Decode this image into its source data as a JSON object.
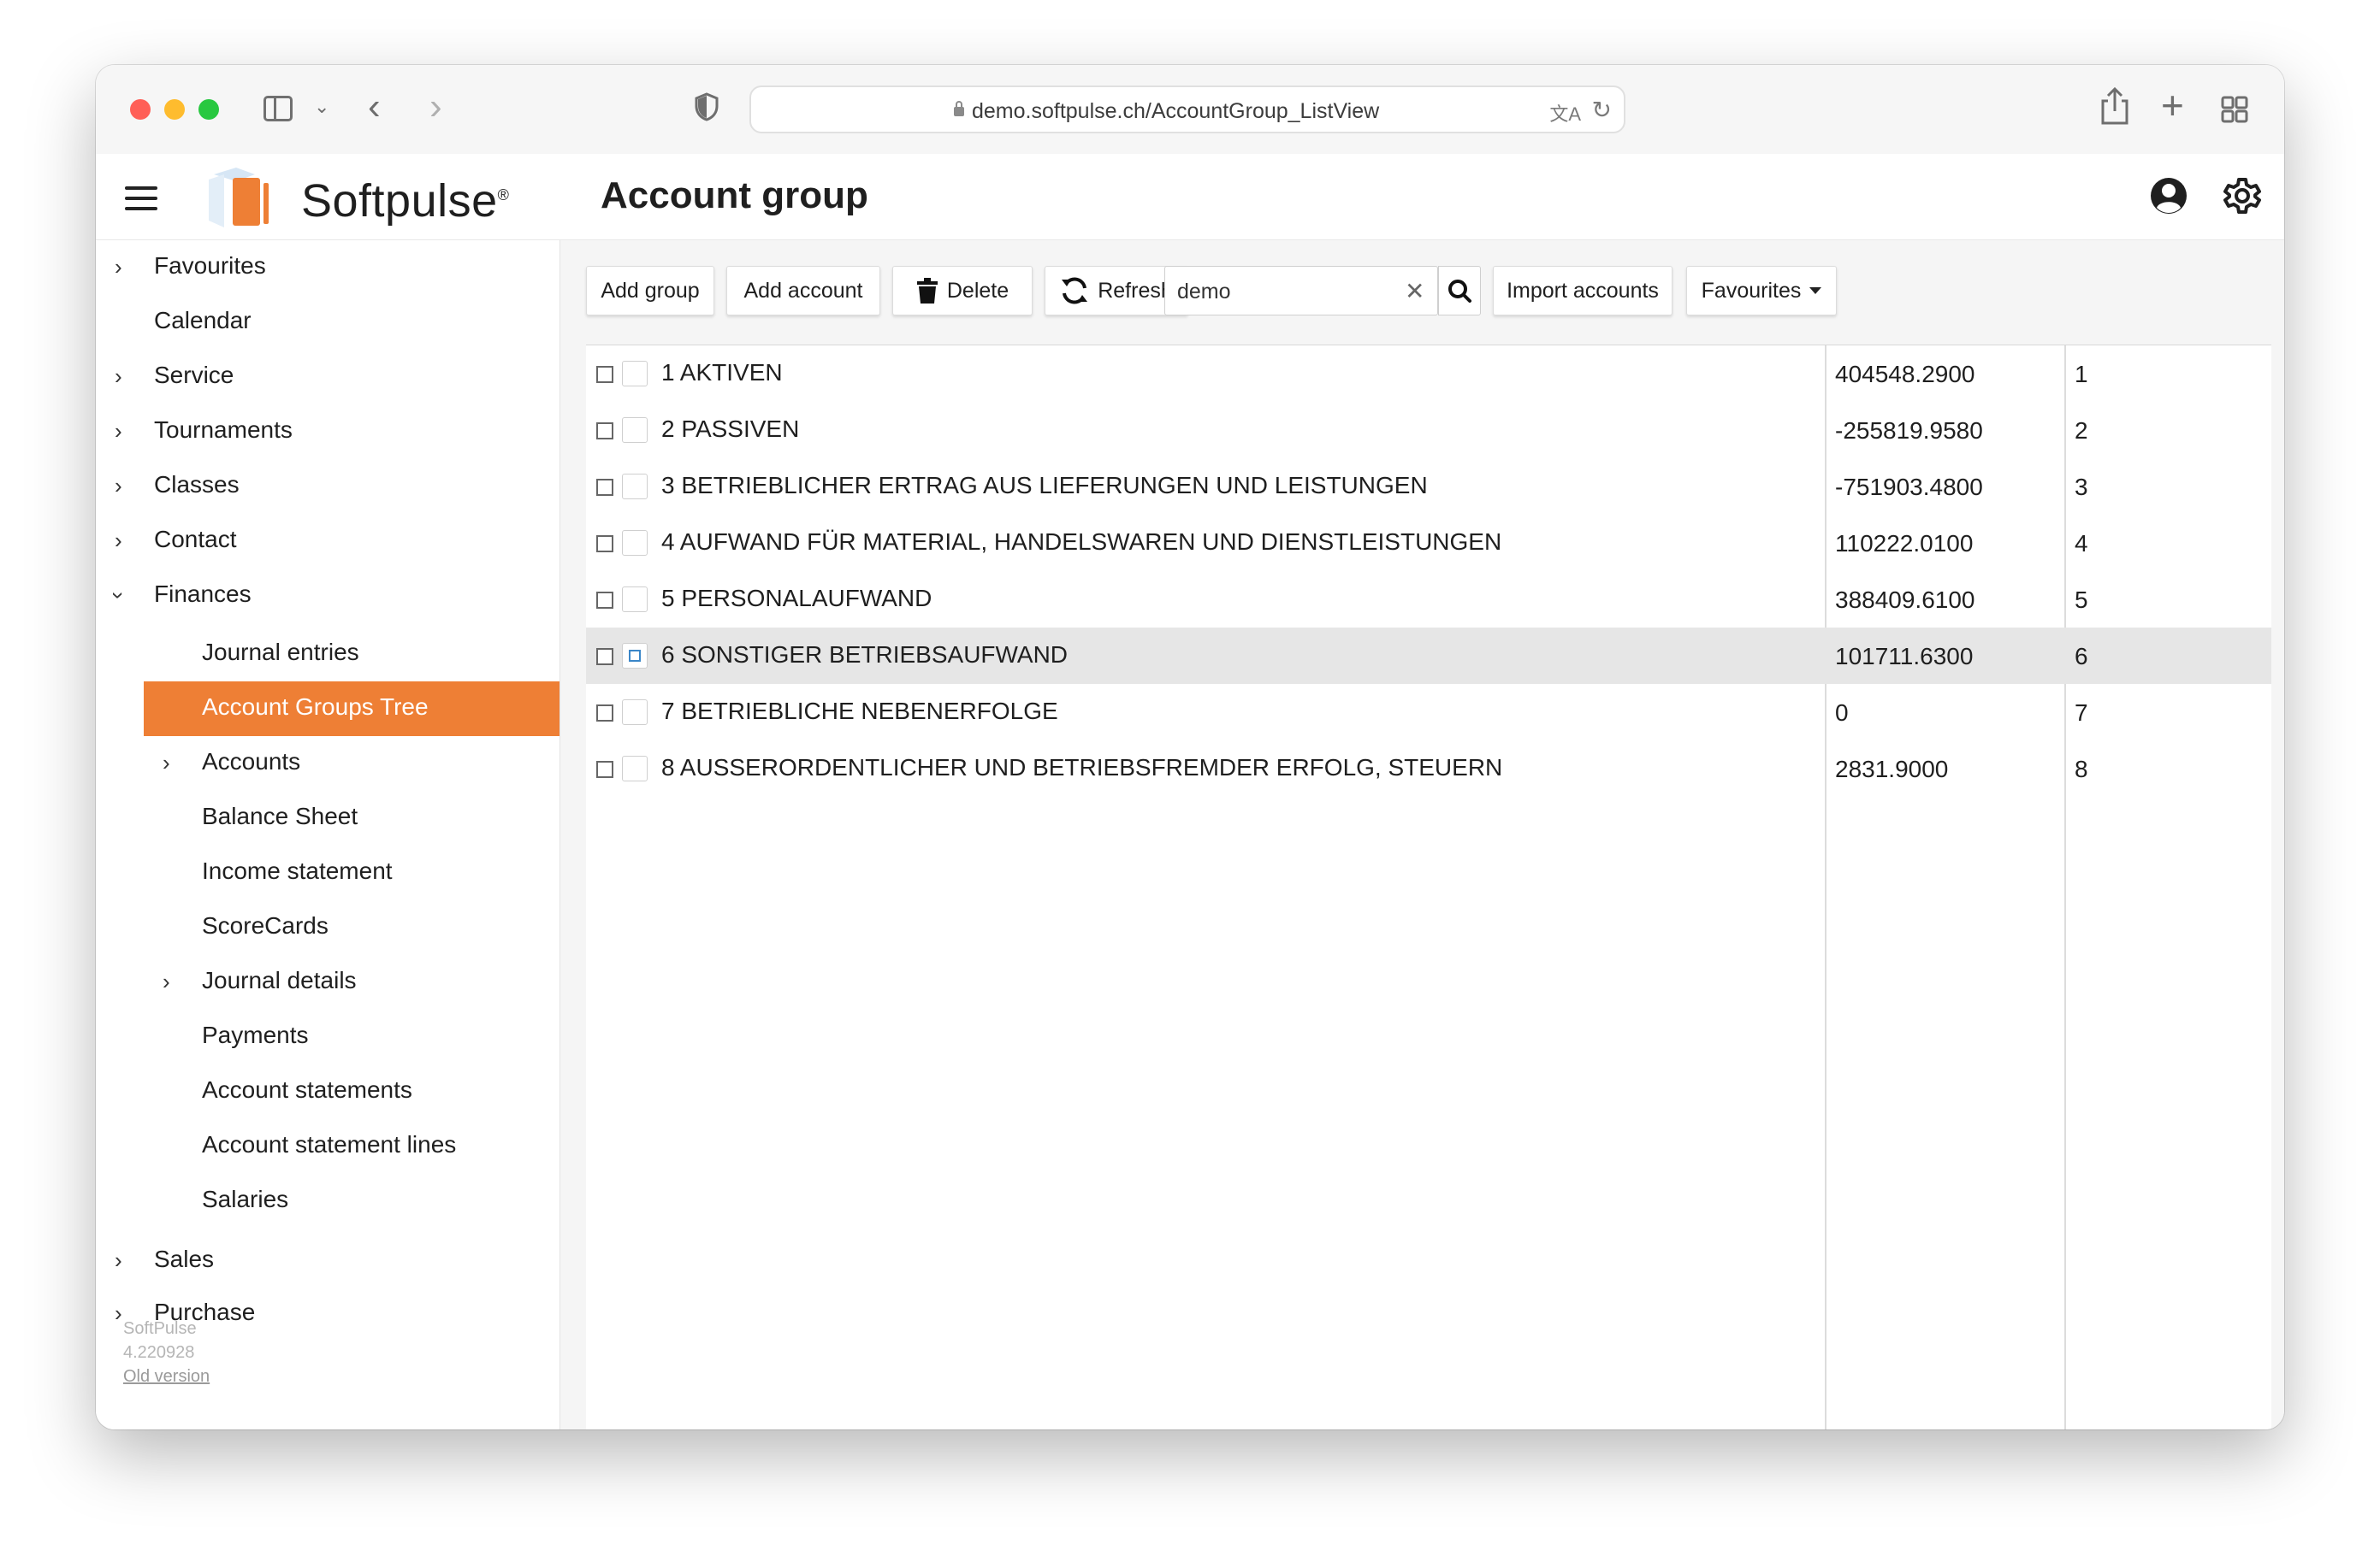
{
  "browser": {
    "url": "demo.softpulse.ch/AccountGroup_ListView"
  },
  "header": {
    "logo_text": "Softpulse",
    "logo_reg": "®",
    "page_title": "Account group",
    "brand_color": "#ee7f35"
  },
  "sidebar": {
    "items": [
      {
        "label": "Favourites",
        "level": 0,
        "expandable": true
      },
      {
        "label": "Calendar",
        "level": 0,
        "expandable": false
      },
      {
        "label": "Service",
        "level": 0,
        "expandable": true
      },
      {
        "label": "Tournaments",
        "level": 0,
        "expandable": true
      },
      {
        "label": "Classes",
        "level": 0,
        "expandable": true
      },
      {
        "label": "Contact",
        "level": 0,
        "expandable": true
      },
      {
        "label": "Finances",
        "level": 0,
        "expandable": true,
        "expanded": true
      },
      {
        "label": "Journal entries",
        "level": 1,
        "expandable": false
      },
      {
        "label": "Account Groups Tree",
        "level": 1,
        "expandable": false,
        "active": true
      },
      {
        "label": "Accounts",
        "level": 1,
        "expandable": true
      },
      {
        "label": "Balance Sheet",
        "level": 1,
        "expandable": false
      },
      {
        "label": "Income statement",
        "level": 1,
        "expandable": false
      },
      {
        "label": "ScoreCards",
        "level": 1,
        "expandable": false
      },
      {
        "label": "Journal details",
        "level": 1,
        "expandable": true
      },
      {
        "label": "Payments",
        "level": 1,
        "expandable": false
      },
      {
        "label": "Account statements",
        "level": 1,
        "expandable": false
      },
      {
        "label": "Account statement lines",
        "level": 1,
        "expandable": false
      },
      {
        "label": "Salaries",
        "level": 1,
        "expandable": false
      },
      {
        "label": "Sales",
        "level": 0,
        "expandable": true
      },
      {
        "label": "Purchase",
        "level": 0,
        "expandable": true
      }
    ],
    "footer": {
      "app_name": "SoftPulse",
      "version": "4.220928",
      "old_version_link": "Old version"
    }
  },
  "toolbar": {
    "add_group": "Add group",
    "add_account": "Add account",
    "delete": "Delete",
    "refresh": "Refresh",
    "search_value": "demo",
    "import_accounts": "Import accounts",
    "favourites": "Favourites"
  },
  "table": {
    "rows": [
      {
        "name": "1 AKTIVEN",
        "amount": "404548.2900",
        "number": "1"
      },
      {
        "name": "2 PASSIVEN",
        "amount": "-255819.9580",
        "number": "2"
      },
      {
        "name": "3 BETRIEBLICHER ERTRAG AUS LIEFERUNGEN UND LEISTUNGEN",
        "amount": "-751903.4800",
        "number": "3"
      },
      {
        "name": "4 AUFWAND FÜR MATERIAL, HANDELSWAREN UND DIENSTLEISTUNGEN",
        "amount": "110222.0100",
        "number": "4"
      },
      {
        "name": "5 PERSONALAUFWAND",
        "amount": "388409.6100",
        "number": "5"
      },
      {
        "name": "6 SONSTIGER BETRIEBSAUFWAND",
        "amount": "101711.6300",
        "number": "6",
        "selected": true
      },
      {
        "name": "7 BETRIEBLICHE NEBENERFOLGE",
        "amount": "0",
        "number": "7"
      },
      {
        "name": "8 AUSSERORDENTLICHER UND BETRIEBSFREMDER ERFOLG, STEUERN",
        "amount": "2831.9000",
        "number": "8"
      }
    ]
  }
}
